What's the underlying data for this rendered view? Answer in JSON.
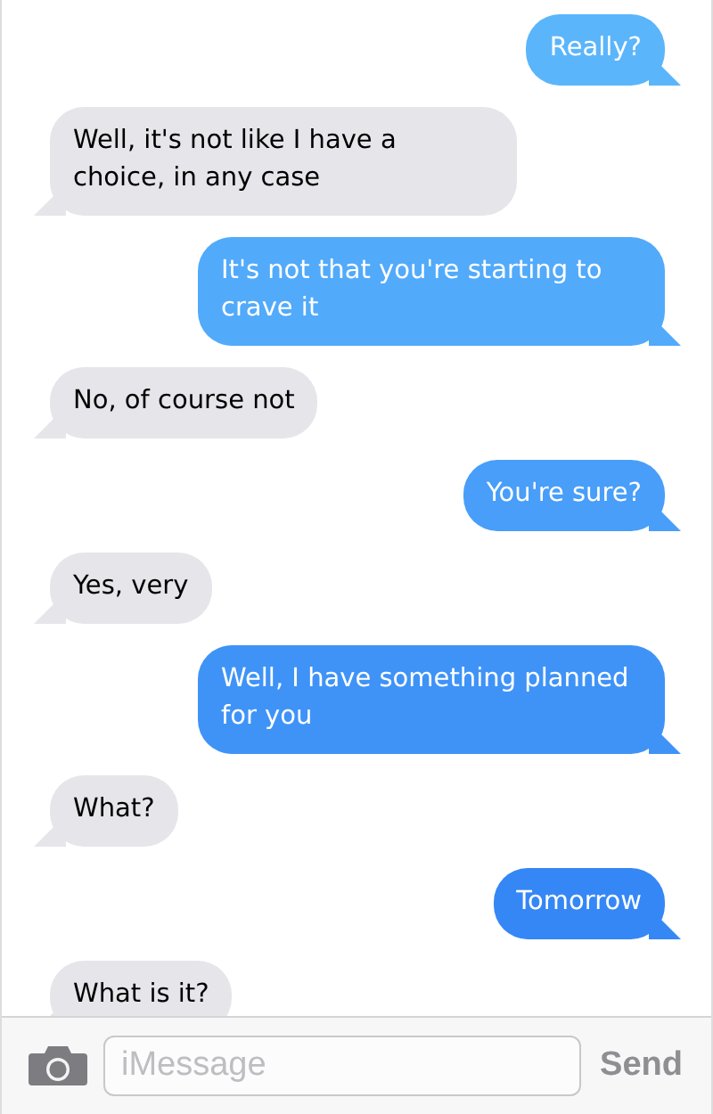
{
  "messages": [
    {
      "kind": "sent",
      "text": "Really?"
    },
    {
      "kind": "received",
      "text": "Well, it's not like I have a choice, in any case"
    },
    {
      "kind": "sent",
      "text": "It's not that you're starting to crave it"
    },
    {
      "kind": "received",
      "text": "No, of course not"
    },
    {
      "kind": "sent",
      "text": "You're sure?"
    },
    {
      "kind": "received",
      "text": "Yes, very"
    },
    {
      "kind": "sent",
      "text": "Well, I have something planned for you"
    },
    {
      "kind": "received",
      "text": "What?"
    },
    {
      "kind": "sent",
      "text": "Tomorrow"
    },
    {
      "kind": "received",
      "text": "What is it?"
    }
  ],
  "compose": {
    "placeholder": "iMessage",
    "send": "Send"
  }
}
